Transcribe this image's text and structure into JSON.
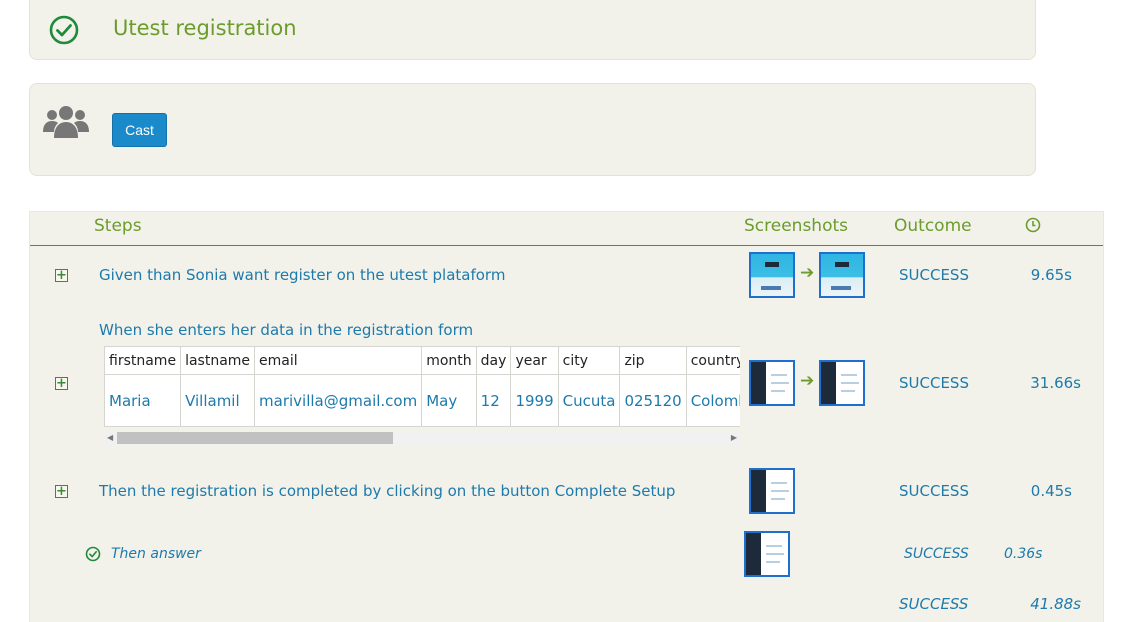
{
  "title": {
    "text": "Utest registration",
    "status_icon": "check-circle-icon",
    "color": "#6b9c2c"
  },
  "cast": {
    "icon": "users-icon",
    "button_label": "Cast",
    "button_color": "#1b8acb"
  },
  "headers": {
    "steps": "Steps",
    "screenshots": "Screenshots",
    "outcome": "Outcome",
    "duration_icon": "clock-icon"
  },
  "steps": [
    {
      "text": "Given than Sonia want register on the utest plataform",
      "outcome": "SUCCESS",
      "duration": "9.65s"
    },
    {
      "text": "When she enters her data in the registration form",
      "outcome": "SUCCESS",
      "duration": "31.66s",
      "table": {
        "columns": [
          "firstname",
          "lastname",
          "email",
          "month",
          "day",
          "year",
          "city",
          "zip",
          "country"
        ],
        "rows": [
          [
            "Maria",
            "Villamil",
            "marivilla@gmail.com",
            "May",
            "12",
            "1999",
            "Cucuta",
            "025120",
            "Colombia"
          ]
        ]
      }
    },
    {
      "text": "Then the registration is completed by clicking on the button Complete Setup",
      "outcome": "SUCCESS",
      "duration": "0.45s"
    }
  ],
  "sub_step": {
    "text": "Then answer",
    "outcome": "SUCCESS",
    "duration": "0.36s"
  },
  "total": {
    "outcome": "SUCCESS",
    "duration": "41.88s"
  },
  "colors": {
    "accent_green": "#6b9c2c",
    "link_blue": "#1e7aab",
    "panel_bg": "#f2f2eb",
    "thumb_border": "#1f6fcf"
  }
}
